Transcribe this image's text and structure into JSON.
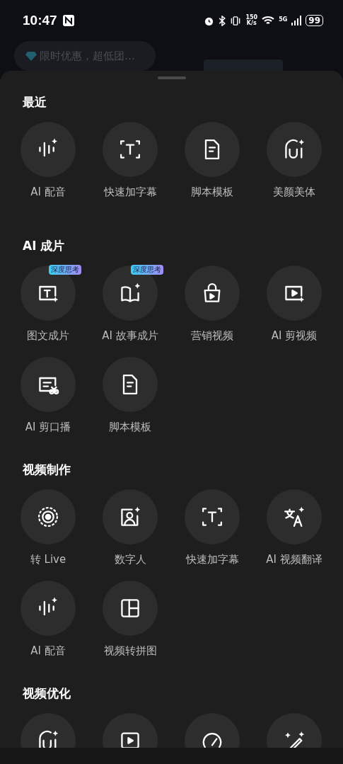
{
  "status_bar": {
    "time": "10:47",
    "speed_value": "150",
    "speed_unit": "K/s",
    "network": "5G",
    "battery": "99"
  },
  "promo": {
    "text": "限时优惠，超低团…"
  },
  "sections": [
    {
      "title": "最近",
      "items": [
        {
          "label": "AI 配音",
          "kind": "voice"
        },
        {
          "label": "快速加字幕",
          "kind": "text-frame"
        },
        {
          "label": "脚本模板",
          "kind": "document"
        },
        {
          "label": "美颜美体",
          "kind": "face"
        }
      ]
    },
    {
      "title": "AI 成片",
      "items": [
        {
          "label": "图文成片",
          "kind": "text-image",
          "badge": "深度思考"
        },
        {
          "label": "AI 故事成片",
          "kind": "book",
          "badge": "深度思考"
        },
        {
          "label": "营销视频",
          "kind": "bag"
        },
        {
          "label": "AI 剪视频",
          "kind": "video-spark"
        },
        {
          "label": "AI 剪口播",
          "kind": "scissors"
        },
        {
          "label": "脚本模板",
          "kind": "document"
        }
      ]
    },
    {
      "title": "视频制作",
      "items": [
        {
          "label": "转 Live",
          "kind": "live"
        },
        {
          "label": "数字人",
          "kind": "person"
        },
        {
          "label": "快速加字幕",
          "kind": "text-frame"
        },
        {
          "label": "AI 视频翻译",
          "kind": "translate"
        },
        {
          "label": "AI 配音",
          "kind": "voice"
        },
        {
          "label": "视频转拼图",
          "kind": "layout"
        }
      ]
    },
    {
      "title": "视频优化",
      "items": [
        {
          "kind": "face"
        },
        {
          "kind": "play"
        },
        {
          "kind": "gauge"
        },
        {
          "kind": "wand"
        }
      ]
    }
  ]
}
